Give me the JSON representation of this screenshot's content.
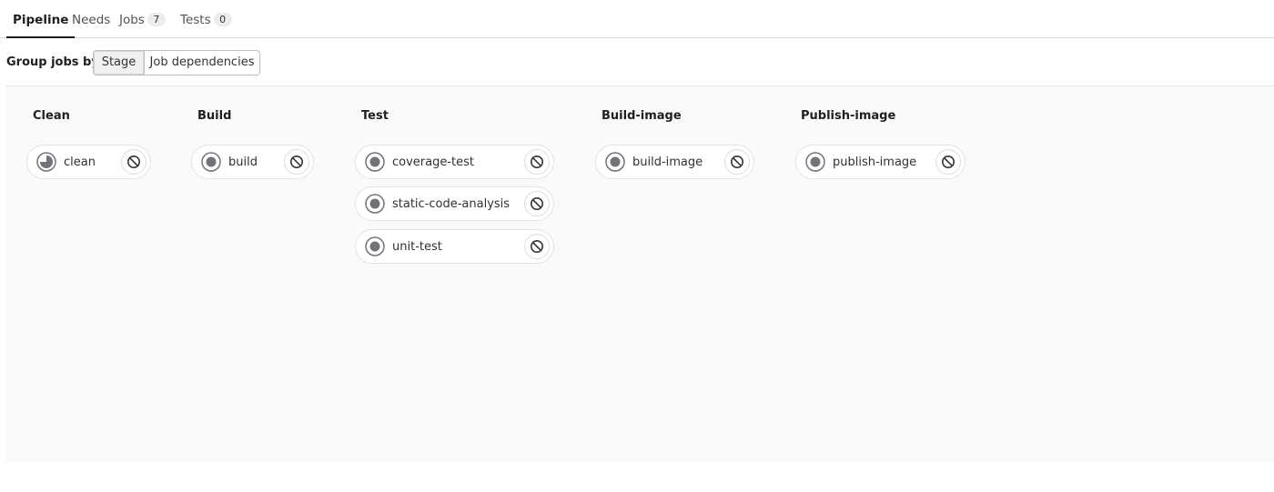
{
  "tabs": {
    "pipeline": "Pipeline",
    "needs": "Needs",
    "jobs": "Jobs",
    "jobs_count": "7",
    "tests": "Tests",
    "tests_count": "0"
  },
  "group_by": {
    "label": "Group jobs by",
    "stage": "Stage",
    "job_dependencies": "Job dependencies",
    "selected": "Stage"
  },
  "stages": [
    {
      "title": "Clean",
      "jobs": [
        {
          "name": "clean",
          "status": "running-icon",
          "action": "cancel-icon"
        }
      ]
    },
    {
      "title": "Build",
      "jobs": [
        {
          "name": "build",
          "status": "pending-icon",
          "action": "cancel-icon"
        }
      ]
    },
    {
      "title": "Test",
      "jobs": [
        {
          "name": "coverage-test",
          "status": "pending-icon",
          "action": "cancel-icon"
        },
        {
          "name": "static-code-analysis",
          "status": "pending-icon",
          "action": "cancel-icon"
        },
        {
          "name": "unit-test",
          "status": "pending-icon",
          "action": "cancel-icon"
        }
      ]
    },
    {
      "title": "Build-image",
      "jobs": [
        {
          "name": "build-image",
          "status": "pending-icon",
          "action": "cancel-icon"
        }
      ]
    },
    {
      "title": "Publish-image",
      "jobs": [
        {
          "name": "publish-image",
          "status": "pending-icon",
          "action": "cancel-icon"
        }
      ]
    }
  ],
  "colors": {
    "status_gray": "#737278",
    "border": "#e3e3e3",
    "area_bg": "#fafafa"
  }
}
